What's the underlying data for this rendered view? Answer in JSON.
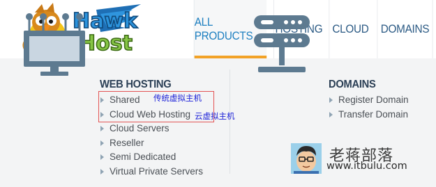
{
  "brand": {
    "logo_line1": "Hawk",
    "logo_line2": "Host",
    "colors": {
      "logo_blue": "#1f8fd6",
      "logo_green": "#7fc241",
      "logo_yellow": "#f5c518"
    }
  },
  "nav": {
    "items": [
      {
        "label": "ALL PRODUCTS",
        "active": true
      },
      {
        "label": "HOSTING",
        "active": false
      },
      {
        "label": "CLOUD",
        "active": false
      },
      {
        "label": "DOMAINS",
        "active": false
      }
    ],
    "colors": {
      "text": "#2b5a84",
      "active_text": "#1d7fc0",
      "active_underline": "#f2a227"
    }
  },
  "menu": {
    "web_hosting": {
      "title": "WEB HOSTING",
      "icon": "monitor-network-icon",
      "items": [
        "Shared",
        "Cloud Web Hosting",
        "Cloud Servers",
        "Reseller",
        "Semi Dedicated",
        "Virtual Private Servers"
      ]
    },
    "domains": {
      "title": "DOMAINS",
      "icon": "server-stack-icon",
      "items": [
        "Register Domain",
        "Transfer Domain"
      ]
    }
  },
  "annotations": {
    "shared_note": "传统虚拟主机",
    "cloud_note": "云虚拟主机",
    "box_color": "#e35353",
    "text_color": "#1a1fd8"
  },
  "watermark": {
    "name": "老蒋部落",
    "url": "www.itbulu.com"
  }
}
